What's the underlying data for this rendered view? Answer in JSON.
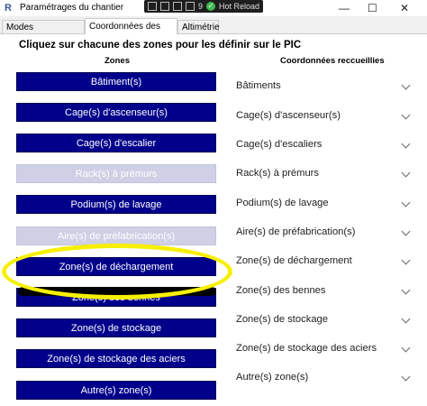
{
  "window": {
    "title": "Paramétrages du chantier",
    "minimize_icon": "minimize-icon",
    "maximize_icon": "maximize-icon",
    "close_icon": "close-icon"
  },
  "debug_toolbar": {
    "count": "9",
    "hot_reload": "Hot Reload"
  },
  "tabs": [
    {
      "label": "Modes constructifs"
    },
    {
      "label": "Coordonnées des zones"
    },
    {
      "label": "Altimétrie"
    }
  ],
  "panel": {
    "heading": "Cliquez sur chacune des zones pour les définir sur le PIC",
    "zones_header": "Zones",
    "coords_header": "Coordonnées reccueillies"
  },
  "zone_buttons": [
    {
      "label": "Bâtiment(s)",
      "enabled": true
    },
    {
      "label": "Cage(s) d'ascenseur(s)",
      "enabled": true
    },
    {
      "label": "Cage(s) d'escalier",
      "enabled": true
    },
    {
      "label": "Rack(s) à prémurs",
      "enabled": false
    },
    {
      "label": "Podium(s) de lavage",
      "enabled": true
    },
    {
      "label": "Aire(s) de préfabrication(s)",
      "enabled": false
    },
    {
      "label": "Zone(s) de déchargement",
      "enabled": true
    },
    {
      "label": "Zone(s) des bennes",
      "enabled": true
    },
    {
      "label": "Zone(s) de stockage",
      "enabled": true
    },
    {
      "label": "Zone(s) de stockage des aciers",
      "enabled": true
    },
    {
      "label": "Autre(s) zone(s)",
      "enabled": true
    }
  ],
  "coord_rows": [
    {
      "label": "Bâtiments"
    },
    {
      "label": "Cage(s) d'ascenseur(s)"
    },
    {
      "label": "Cage(s) d'escaliers"
    },
    {
      "label": "Rack(s) à prémurs"
    },
    {
      "label": "Podium(s) de lavage"
    },
    {
      "label": "Aire(s) de préfabrication(s)"
    },
    {
      "label": "Zone(s) de déchargement"
    },
    {
      "label": "Zone(s) des bennes"
    },
    {
      "label": "Zone(s) de stockage"
    },
    {
      "label": "Zone(s) de stockage des aciers"
    },
    {
      "label": "Autre(s) zone(s)"
    }
  ],
  "colors": {
    "button_blue": "#00008b",
    "button_disabled": "#cfcfe6",
    "highlight": "#f6f000"
  }
}
